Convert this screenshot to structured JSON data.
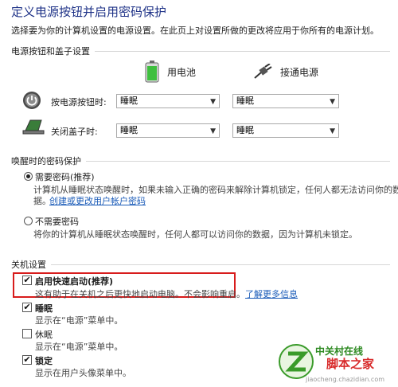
{
  "title": "定义电源按钮并启用密码保护",
  "description": "选择要为你的计算机设置的电源设置。在此页上对设置所做的更改将应用于你所有的电源计划。",
  "power_buttons": {
    "section": "电源按钮和盖子设置",
    "col_battery": "用电池",
    "col_plugged": "接通电源",
    "rows": [
      {
        "label": "按电源按钮时:",
        "battery": "睡眠",
        "plugged": "睡眠"
      },
      {
        "label": "关闭盖子时:",
        "battery": "睡眠",
        "plugged": "睡眠"
      }
    ]
  },
  "wake_password": {
    "section": "唤醒时的密码保护",
    "require_label": "需要密码(推荐)",
    "require_desc": "计算机从睡眠状态唤醒时，如果未输入正确的密码来解除计算机锁定，任何人都无法访问你的数",
    "require_desc2": "据。",
    "require_link": "创建或更改用户帐户密码",
    "norequire_label": "不需要密码",
    "norequire_desc": "将你的计算机从睡眠状态唤醒时，任何人都可以访问你的数据，因为计算机未锁定。",
    "selected": "需要密码(推荐)"
  },
  "shutdown": {
    "section": "关机设置",
    "items": [
      {
        "label": "启用快速启动(推荐)",
        "desc": "这有助于在关机之后更快地启动电脑。不会影响重启。",
        "link": "了解更多信息",
        "checked": true
      },
      {
        "label": "睡眠",
        "desc": "显示在“电源”菜单中。",
        "checked": true
      },
      {
        "label": "休眠",
        "desc": "显示在“电源”菜单中。",
        "checked": false
      },
      {
        "label": "锁定",
        "desc": "显示在用户头像菜单中。",
        "checked": true
      }
    ]
  },
  "watermark": {
    "brand": "中关村在线",
    "site": "脚本之家",
    "url": "jiaocheng.chazidian.com"
  },
  "colors": {
    "accent": "#1e3287",
    "link": "#1a5bb8",
    "highlight_border": "#d81c1c"
  }
}
